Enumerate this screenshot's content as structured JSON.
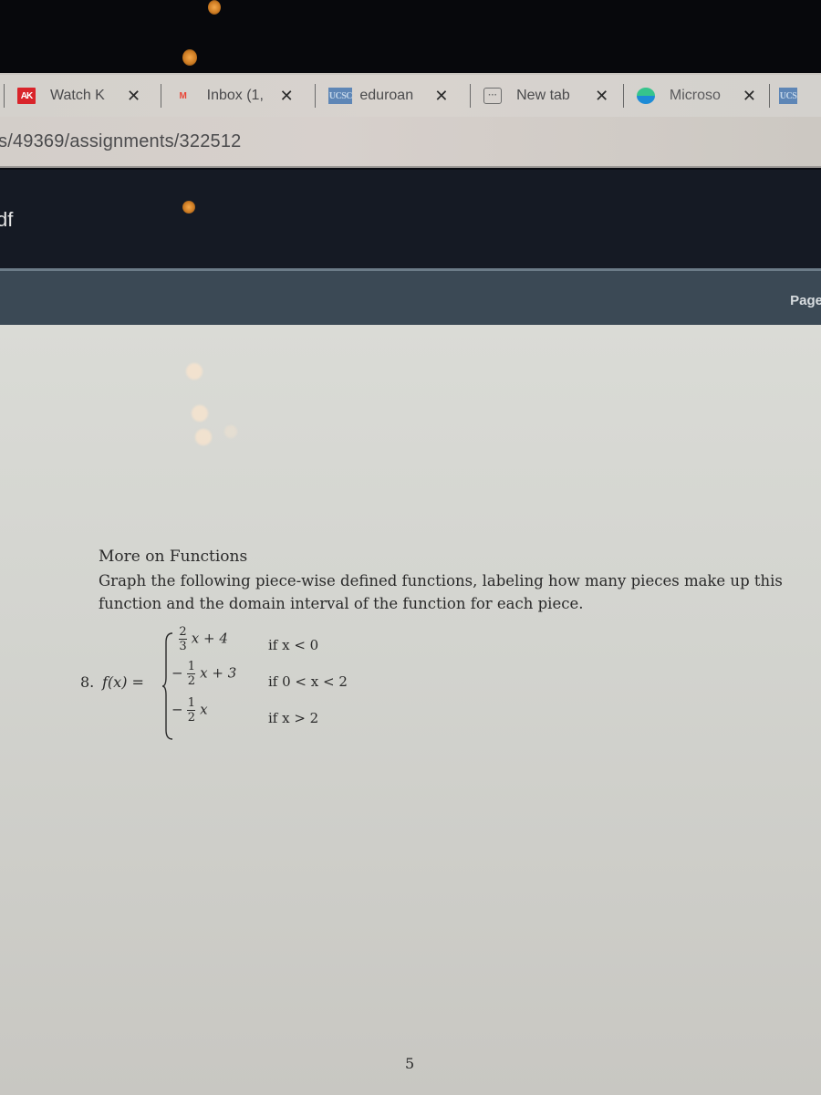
{
  "browser": {
    "tabs": [
      {
        "icon": "ak-icon",
        "favicon_text": "AK",
        "label": "Watch K",
        "close": "✕"
      },
      {
        "icon": "gmail-icon",
        "favicon_text": "M",
        "label": "Inbox (1,",
        "close": "✕"
      },
      {
        "icon": "ucsc-icon",
        "favicon_text": "UCSC",
        "label": "eduroan",
        "close": "✕"
      },
      {
        "icon": "new-tab-icon",
        "favicon_text": "···",
        "label": "New tab",
        "close": "✕"
      },
      {
        "icon": "edge-icon",
        "favicon_text": "",
        "label": "Microso",
        "close": "✕"
      },
      {
        "icon": "ucsc-icon",
        "favicon_text": "UCS",
        "label": "",
        "close": ""
      }
    ],
    "url": "s/49369/assignments/322512"
  },
  "app": {
    "doc_title": "df",
    "toolbar": {
      "page_label": "Page"
    }
  },
  "document": {
    "section_title": "More on Functions",
    "instruction": "Graph the following piece-wise defined functions, labeling how many pieces make up this function and the domain interval of the function for each piece.",
    "problem": {
      "number": "8.",
      "function_lhs": "f(x) =",
      "cases": [
        {
          "coef_num": "2",
          "coef_den": "3",
          "sign": "",
          "expr": "x + 4",
          "condition": "if x < 0"
        },
        {
          "coef_num": "1",
          "coef_den": "2",
          "sign": "−",
          "expr": "x + 3",
          "condition": "if 0 < x < 2"
        },
        {
          "coef_num": "1",
          "coef_den": "2",
          "sign": "−",
          "expr": "x",
          "condition": "if x > 2"
        }
      ]
    },
    "page_number": "5"
  }
}
